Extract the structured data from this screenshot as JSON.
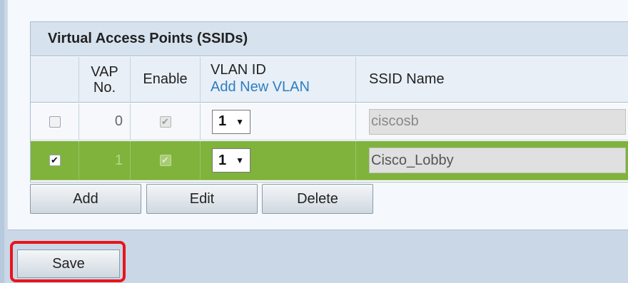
{
  "section_title": "Virtual Access Points (SSIDs)",
  "columns": {
    "vap_no": "VAP\nNo.",
    "enable": "Enable",
    "vlan_id": "VLAN ID",
    "add_new_vlan": "Add New VLAN",
    "ssid_name": "SSID Name"
  },
  "rows": [
    {
      "vap_no": "0",
      "vlan": "1",
      "ssid": "ciscosb",
      "selected": false,
      "enabled": true
    },
    {
      "vap_no": "1",
      "vlan": "1",
      "ssid": "Cisco_Lobby",
      "selected": true,
      "enabled": true
    }
  ],
  "buttons": {
    "add": "Add",
    "edit": "Edit",
    "delete": "Delete",
    "save": "Save"
  },
  "colors": {
    "selected_row": "#7fb33c",
    "highlight": "#e8141b"
  }
}
